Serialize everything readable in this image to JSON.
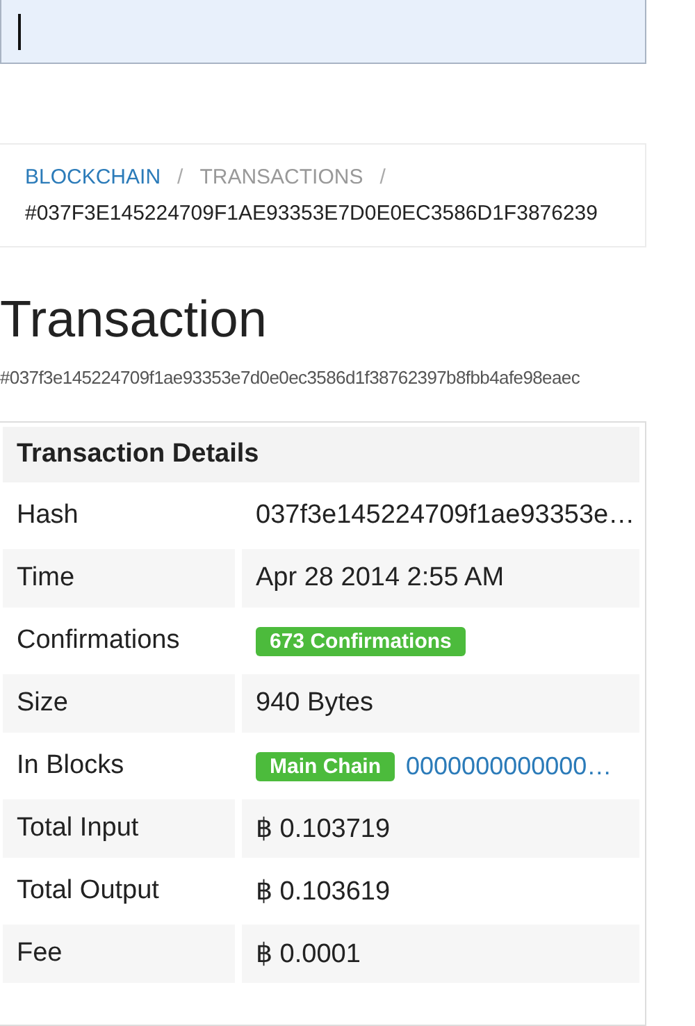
{
  "search_field": {
    "focused": true
  },
  "breadcrumb": [
    {
      "label": "BLOCKCHAIN",
      "kind": "link"
    },
    {
      "label": "TRANSACTIONS",
      "kind": "muted"
    },
    {
      "label": "#037F3E145224709F1AE93353E7D0E0EC3586D1F3876239",
      "kind": "current"
    }
  ],
  "separator": "/",
  "title": "Transaction",
  "hash_line": "#037f3e145224709f1ae93353e7d0e0ec3586d1f38762397b8fbb4afe98eaec",
  "details": {
    "title": "Transaction Details",
    "rows": [
      {
        "label": "Hash",
        "kind": "text",
        "value": "037f3e145224709f1ae93353e…"
      },
      {
        "label": "Time",
        "kind": "text",
        "value": "Apr 28 2014 2:55 AM"
      },
      {
        "label": "Confirmations",
        "kind": "badge",
        "badge": "673 Confirmations"
      },
      {
        "label": "Size",
        "kind": "text",
        "value": "940 Bytes"
      },
      {
        "label": "In Blocks",
        "kind": "block",
        "badge": "Main Chain",
        "link": "0000000000000…"
      },
      {
        "label": "Total Input",
        "kind": "text",
        "value": "฿ 0.103719"
      },
      {
        "label": "Total Output",
        "kind": "text",
        "value": "฿ 0.103619"
      },
      {
        "label": "Fee",
        "kind": "text",
        "value": "฿ 0.0001"
      }
    ]
  }
}
